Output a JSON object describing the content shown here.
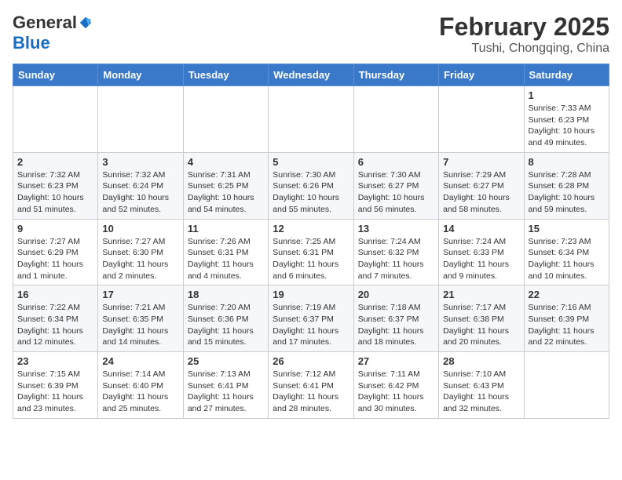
{
  "header": {
    "logo": {
      "general": "General",
      "blue": "Blue"
    },
    "title": "February 2025",
    "location": "Tushi, Chongqing, China"
  },
  "days_of_week": [
    "Sunday",
    "Monday",
    "Tuesday",
    "Wednesday",
    "Thursday",
    "Friday",
    "Saturday"
  ],
  "weeks": [
    [
      {
        "day": "",
        "info": ""
      },
      {
        "day": "",
        "info": ""
      },
      {
        "day": "",
        "info": ""
      },
      {
        "day": "",
        "info": ""
      },
      {
        "day": "",
        "info": ""
      },
      {
        "day": "",
        "info": ""
      },
      {
        "day": "1",
        "info": "Sunrise: 7:33 AM\nSunset: 6:23 PM\nDaylight: 10 hours and 49 minutes."
      }
    ],
    [
      {
        "day": "2",
        "info": "Sunrise: 7:32 AM\nSunset: 6:23 PM\nDaylight: 10 hours and 51 minutes."
      },
      {
        "day": "3",
        "info": "Sunrise: 7:32 AM\nSunset: 6:24 PM\nDaylight: 10 hours and 52 minutes."
      },
      {
        "day": "4",
        "info": "Sunrise: 7:31 AM\nSunset: 6:25 PM\nDaylight: 10 hours and 54 minutes."
      },
      {
        "day": "5",
        "info": "Sunrise: 7:30 AM\nSunset: 6:26 PM\nDaylight: 10 hours and 55 minutes."
      },
      {
        "day": "6",
        "info": "Sunrise: 7:30 AM\nSunset: 6:27 PM\nDaylight: 10 hours and 56 minutes."
      },
      {
        "day": "7",
        "info": "Sunrise: 7:29 AM\nSunset: 6:27 PM\nDaylight: 10 hours and 58 minutes."
      },
      {
        "day": "8",
        "info": "Sunrise: 7:28 AM\nSunset: 6:28 PM\nDaylight: 10 hours and 59 minutes."
      }
    ],
    [
      {
        "day": "9",
        "info": "Sunrise: 7:27 AM\nSunset: 6:29 PM\nDaylight: 11 hours and 1 minute."
      },
      {
        "day": "10",
        "info": "Sunrise: 7:27 AM\nSunset: 6:30 PM\nDaylight: 11 hours and 2 minutes."
      },
      {
        "day": "11",
        "info": "Sunrise: 7:26 AM\nSunset: 6:31 PM\nDaylight: 11 hours and 4 minutes."
      },
      {
        "day": "12",
        "info": "Sunrise: 7:25 AM\nSunset: 6:31 PM\nDaylight: 11 hours and 6 minutes."
      },
      {
        "day": "13",
        "info": "Sunrise: 7:24 AM\nSunset: 6:32 PM\nDaylight: 11 hours and 7 minutes."
      },
      {
        "day": "14",
        "info": "Sunrise: 7:24 AM\nSunset: 6:33 PM\nDaylight: 11 hours and 9 minutes."
      },
      {
        "day": "15",
        "info": "Sunrise: 7:23 AM\nSunset: 6:34 PM\nDaylight: 11 hours and 10 minutes."
      }
    ],
    [
      {
        "day": "16",
        "info": "Sunrise: 7:22 AM\nSunset: 6:34 PM\nDaylight: 11 hours and 12 minutes."
      },
      {
        "day": "17",
        "info": "Sunrise: 7:21 AM\nSunset: 6:35 PM\nDaylight: 11 hours and 14 minutes."
      },
      {
        "day": "18",
        "info": "Sunrise: 7:20 AM\nSunset: 6:36 PM\nDaylight: 11 hours and 15 minutes."
      },
      {
        "day": "19",
        "info": "Sunrise: 7:19 AM\nSunset: 6:37 PM\nDaylight: 11 hours and 17 minutes."
      },
      {
        "day": "20",
        "info": "Sunrise: 7:18 AM\nSunset: 6:37 PM\nDaylight: 11 hours and 18 minutes."
      },
      {
        "day": "21",
        "info": "Sunrise: 7:17 AM\nSunset: 6:38 PM\nDaylight: 11 hours and 20 minutes."
      },
      {
        "day": "22",
        "info": "Sunrise: 7:16 AM\nSunset: 6:39 PM\nDaylight: 11 hours and 22 minutes."
      }
    ],
    [
      {
        "day": "23",
        "info": "Sunrise: 7:15 AM\nSunset: 6:39 PM\nDaylight: 11 hours and 23 minutes."
      },
      {
        "day": "24",
        "info": "Sunrise: 7:14 AM\nSunset: 6:40 PM\nDaylight: 11 hours and 25 minutes."
      },
      {
        "day": "25",
        "info": "Sunrise: 7:13 AM\nSunset: 6:41 PM\nDaylight: 11 hours and 27 minutes."
      },
      {
        "day": "26",
        "info": "Sunrise: 7:12 AM\nSunset: 6:41 PM\nDaylight: 11 hours and 28 minutes."
      },
      {
        "day": "27",
        "info": "Sunrise: 7:11 AM\nSunset: 6:42 PM\nDaylight: 11 hours and 30 minutes."
      },
      {
        "day": "28",
        "info": "Sunrise: 7:10 AM\nSunset: 6:43 PM\nDaylight: 11 hours and 32 minutes."
      },
      {
        "day": "",
        "info": ""
      }
    ]
  ]
}
